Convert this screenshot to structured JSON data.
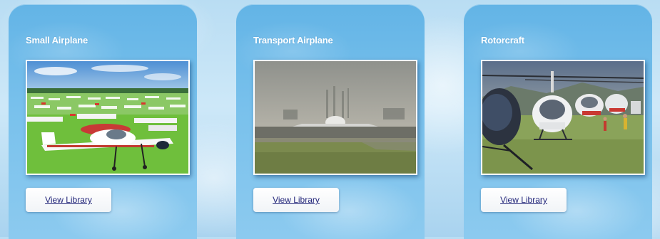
{
  "cards": [
    {
      "title": "Small Airplane",
      "button_label": "View Library",
      "image_subject": "small-airplanes-field-photo"
    },
    {
      "title": "Transport Airplane",
      "button_label": "View Library",
      "image_subject": "transport-airplanes-runway-photo"
    },
    {
      "title": "Rotorcraft",
      "button_label": "View Library",
      "image_subject": "helicopters-field-photo"
    }
  ],
  "colors": {
    "card_blue": "#6fbce9",
    "title_text": "#ffffff",
    "link_text": "#23267a",
    "button_bg": "#ffffff"
  }
}
